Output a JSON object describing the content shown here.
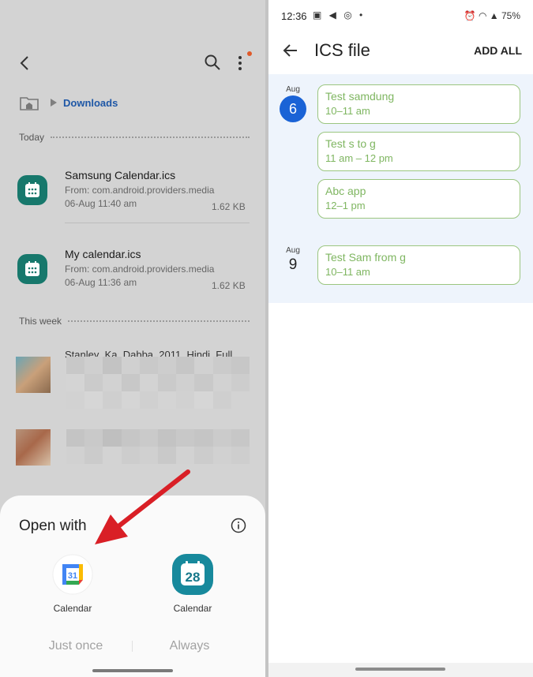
{
  "left": {
    "breadcrumb": {
      "folder": "Downloads"
    },
    "sections": {
      "today": "Today",
      "this_week": "This week"
    },
    "files": [
      {
        "name": "Samsung Calendar.ics",
        "from": "From: com.android.providers.media",
        "date": "06-Aug 11:40 am",
        "size": "1.62 KB"
      },
      {
        "name": "My calendar.ics",
        "from": "From: com.android.providers.media",
        "date": "06-Aug 11:36 am",
        "size": "1.62 KB"
      }
    ],
    "week_files": [
      {
        "name": "Stanley_Ka_Dabba_2011_Hindi_Full..."
      }
    ],
    "sheet": {
      "title": "Open with",
      "apps": [
        {
          "label": "Calendar",
          "icon": "google-calendar-icon",
          "day": "31"
        },
        {
          "label": "Calendar",
          "icon": "samsung-calendar-icon",
          "day": "28"
        }
      ],
      "just_once": "Just once",
      "always": "Always"
    }
  },
  "right": {
    "status": {
      "time": "12:36",
      "icons": "▣ ◀ ◎ •",
      "right": "⏰ ◠ ▲ 75%"
    },
    "title": "ICS file",
    "add_all": "ADD ALL",
    "days": [
      {
        "month": "Aug",
        "day": "6",
        "today": true
      },
      {
        "month": "Aug",
        "day": "9",
        "today": false
      }
    ],
    "events": [
      {
        "title": "Test samdung",
        "time": "10–11 am"
      },
      {
        "title": "Test s to g",
        "time": "11 am – 12 pm"
      },
      {
        "title": "Abc app",
        "time": "12–1 pm"
      },
      {
        "title": "Test Sam from g",
        "time": "10–11 am"
      }
    ]
  },
  "colors": {
    "accent_blue": "#1a63d6",
    "event_green": "#7fb661",
    "teal": "#17786c",
    "arrow_red": "#d91f26"
  }
}
